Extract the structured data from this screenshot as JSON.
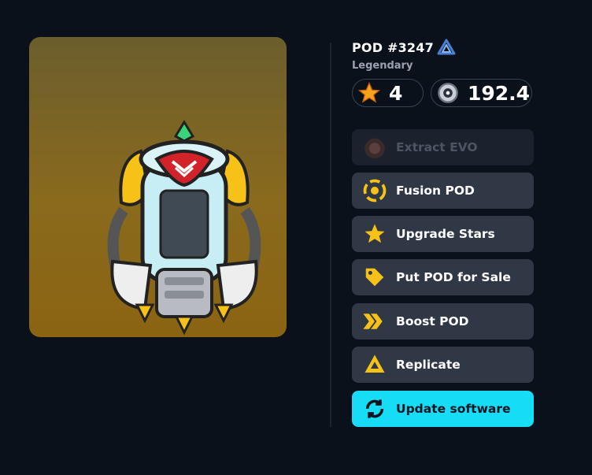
{
  "pod": {
    "title": "POD #3247",
    "rarity": "Legendary",
    "stars": "4",
    "cores": "192.4",
    "card_color_top": "#6b5e2d",
    "card_color_bottom": "#8b6412"
  },
  "actions": {
    "extract_evo": "Extract EVO",
    "fusion": "Fusion POD",
    "upgrade_stars": "Upgrade Stars",
    "sale": "Put POD for Sale",
    "boost": "Boost POD",
    "replicate": "Replicate",
    "update": "Update software"
  },
  "colors": {
    "background": "#0b111b",
    "button": "#303846",
    "button_disabled": "#1b222d",
    "primary": "#16dcf5",
    "accent_yellow": "#f6c217"
  },
  "icons": [
    "chain-link-icon",
    "evo-icon",
    "fusion-icon",
    "star-icon",
    "tag-icon",
    "boost-icon",
    "replicate-icon",
    "refresh-icon",
    "core-icon"
  ]
}
